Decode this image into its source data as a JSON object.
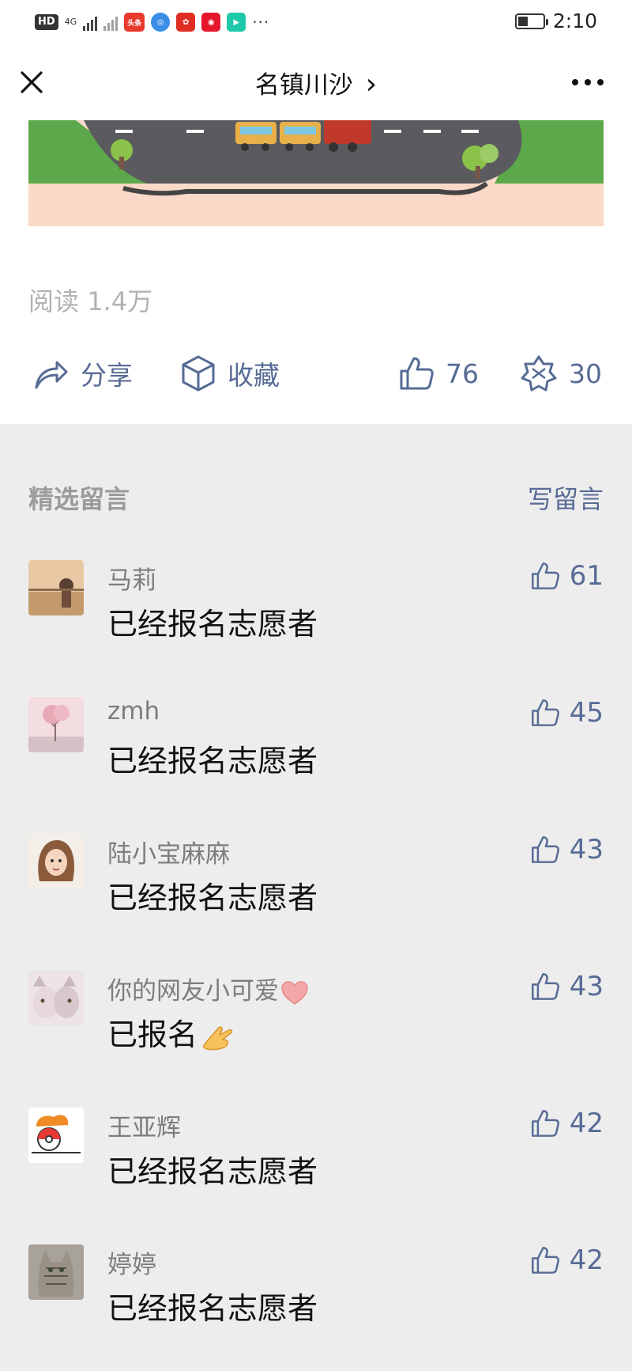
{
  "status_bar": {
    "hd_label": "HD",
    "network_label": "4G",
    "app_icons": [
      "头条",
      "browser",
      "pinduoduo",
      "weibo",
      "video"
    ],
    "more_dots": "···",
    "time": "2:10"
  },
  "nav": {
    "title": "名镇川沙",
    "chevron": "›"
  },
  "article": {
    "read_label": "阅读",
    "read_count": "1.4万",
    "share_label": "分享",
    "favorite_label": "收藏",
    "like_count": "76",
    "wow_count": "30"
  },
  "comments": {
    "section_title": "精选留言",
    "write_label": "写留言",
    "items": [
      {
        "name": "马莉",
        "text": "已经报名志愿者",
        "likes": "61",
        "avatar": "sunset-girl"
      },
      {
        "name": "zmh",
        "text": "已经报名志愿者",
        "likes": "45",
        "avatar": "pink-tree"
      },
      {
        "name": "陆小宝麻麻",
        "text": "已经报名志愿者",
        "likes": "43",
        "avatar": "cartoon-girl"
      },
      {
        "name": "你的网友小可爱",
        "text": "已报名",
        "likes": "43",
        "avatar": "anime-cats"
      },
      {
        "name": "王亚辉",
        "text": "已经报名志愿者",
        "likes": "42",
        "avatar": "pokeball-pet"
      },
      {
        "name": "婷婷",
        "text": "已经报名志愿者",
        "likes": "42",
        "avatar": "tabby-cat"
      }
    ]
  },
  "colors": {
    "link_blue": "#576b95",
    "muted_text": "#b2b2b2",
    "comment_bg": "#ededed"
  },
  "icons": [
    "close-icon",
    "more-icon",
    "share-icon",
    "favorite-icon",
    "like-icon",
    "wow-icon",
    "heart-emoji",
    "ok-hand-emoji"
  ]
}
